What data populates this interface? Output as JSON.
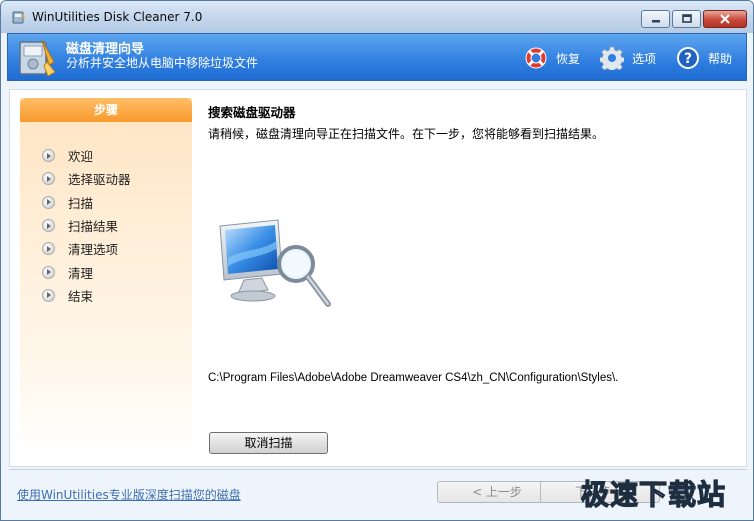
{
  "window": {
    "title": "WinUtilities Disk Cleaner 7.0"
  },
  "banner": {
    "title": "磁盘清理向导",
    "subtitle": "分析并安全地从电脑中移除垃圾文件",
    "actions": [
      {
        "label": "恢复",
        "icon": "lifebuoy-icon"
      },
      {
        "label": "选项",
        "icon": "gear-icon"
      },
      {
        "label": "帮助",
        "icon": "help-icon"
      }
    ]
  },
  "steps": {
    "header": "步骤",
    "items": [
      "欢迎",
      "选择驱动器",
      "扫描",
      "扫描结果",
      "清理选项",
      "清理",
      "结束"
    ]
  },
  "main": {
    "title": "搜索磁盘驱动器",
    "description": "请稍候，磁盘清理向导正在扫描文件。在下一步，您将能够看到扫描结果。",
    "current_path": "C:\\Program Files\\Adobe\\Adobe Dreamweaver CS4\\zh_CN\\Configuration\\Styles\\.",
    "cancel_label": "取消扫描"
  },
  "footer": {
    "link": "使用WinUtilities专业版深度扫描您的磁盘",
    "prev_label": "< 上一步",
    "next_label": "下一步 >"
  },
  "watermark": "极速下载站",
  "colors": {
    "banner": "#2f7ee0",
    "steps_header": "#f79a2c",
    "link": "#3d6fb0"
  }
}
